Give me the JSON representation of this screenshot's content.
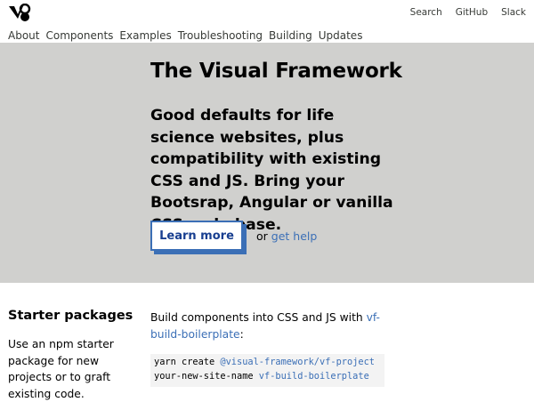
{
  "header": {
    "logo_name": "visual-framework-logo",
    "links": [
      "Search",
      "GitHub",
      "Slack"
    ]
  },
  "nav": {
    "items": [
      "About",
      "Components",
      "Examples",
      "Troubleshooting",
      "Building",
      "Updates"
    ]
  },
  "hero": {
    "title": "The Visual Framework",
    "text": "Good defaults for life science websites, plus compatibility with existing CSS and JS. Bring your Bootsrap, Angular or vanilla CSS code base.",
    "button_label": "Learn more",
    "or_text": "or",
    "help_link": "get help",
    "background_color": "#d0d0ce",
    "accent_color": "#3b6fb6"
  },
  "starter": {
    "heading": "Starter packages",
    "description": "Use an npm starter package for new projects or to graft existing code.",
    "build_text": "Build components into CSS and JS with",
    "build_link": "vf-build-boilerplate",
    "build_suffix": ":",
    "code_line1_plain": "yarn create ",
    "code_line1_link": "@visual-framework/vf-project",
    "code_line2_plain": "your-new-site-name ",
    "code_line2_link": "vf-build-boilerplate"
  }
}
